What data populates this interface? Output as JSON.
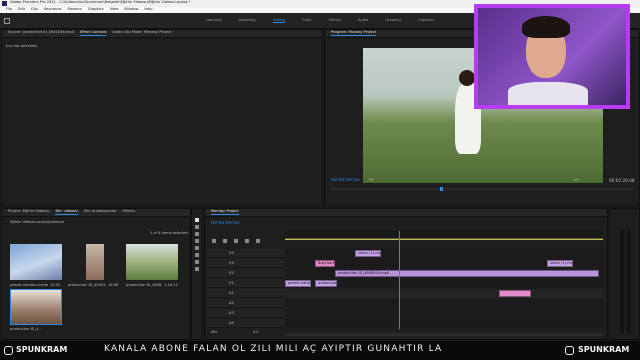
{
  "app": {
    "title": "Adobe Premiere Pro 2021 - C:\\Kullanıcılar\\Spunkram\\Belgeler\\Eğitim Videosu\\Eğitim Videosu.prproj *"
  },
  "menu": [
    "File",
    "Edit",
    "Clip",
    "Sequence",
    "Markers",
    "Graphics",
    "View",
    "Window",
    "Help"
  ],
  "workspaces": {
    "items": [
      "Learning",
      "Assembly",
      "Editing",
      "Color",
      "Effects",
      "Audio",
      "Graphics",
      "Captions"
    ],
    "active": "Editing"
  },
  "source_panel": {
    "tabs": [
      "Source: production ID_4540246.mp4",
      "Effect Controls",
      "Audio Clip Mixer: Monday Project"
    ],
    "active_tab": "Effect Controls",
    "body_text": "(no clip selected)"
  },
  "program_monitor": {
    "title": "Program: Monday Project",
    "timecode": "00:00:49:58",
    "duration": "00:02:20:48",
    "zoom": "Fit",
    "resolution": "1/4",
    "playhead_fraction": 0.36
  },
  "project_panel": {
    "tabs": [
      "Project: Eğitim Videosu",
      "Bin: videolar",
      "Bin: animasyonlar",
      "Effects"
    ],
    "active_tab": "Bin: videolar",
    "path": "Eğitim Videosu.prproj\\videolar",
    "status": "1 of 4 items selected",
    "items": [
      {
        "name": "pexels-natalia-vinchenz...",
        "duration": "12:02"
      },
      {
        "name": "production ID_4540246...",
        "duration": "16:08"
      },
      {
        "name": "production ID_4808...",
        "duration": "1:18:12"
      },
      {
        "name": "production ID_4..."
      }
    ]
  },
  "timeline": {
    "tab": "Monday Project",
    "timecode": "00:00:49:58",
    "video_tracks": [
      "V4",
      "V3",
      "V2",
      "V1"
    ],
    "audio_tracks": [
      "A1",
      "A2",
      "A3",
      "A4"
    ],
    "master_label": "Mix",
    "master_value": "0.0",
    "clips": [
      {
        "label": "video (1).mp4",
        "track": "V4",
        "color": "#c7a1e6"
      },
      {
        "label": "Bilgi Kartı",
        "track": "V3",
        "color": "#e38ac8"
      },
      {
        "label": "production ID_4808504.mp4",
        "track": "V2",
        "color": "#b893dc"
      },
      {
        "label": "pexels-natal...",
        "track": "V1",
        "color": "#c7a1e6"
      },
      {
        "label": "production ID...",
        "track": "V1",
        "color": "#c7a1e6"
      },
      {
        "label": "video (1).mp4",
        "track": "V3",
        "color": "#c7a1e6"
      },
      {
        "label": "",
        "track": "A1",
        "color": "#e38ac8"
      }
    ],
    "playhead_fraction": 0.36
  },
  "banner": {
    "left_handle": "SPUNKRAM",
    "ticker": "KANALA ABONE FALAN OL ZİLİ MİLİ AÇ AYIPTIR GÜNAHTIR LA",
    "right_handle": "SPUNKRAM"
  },
  "colors": {
    "accent": "#2d8ceb",
    "clip_violet": "#c7a1e6",
    "clip_pink": "#e38ac8",
    "webcam_purple": "#b83bf5"
  }
}
